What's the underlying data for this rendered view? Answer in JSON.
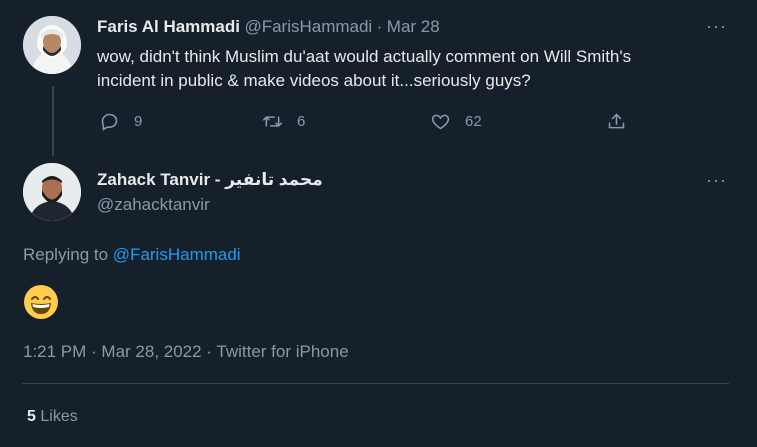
{
  "parent_tweet": {
    "author_name": "Faris Al Hammadi",
    "author_handle": "@FarisHammadi",
    "separator": "·",
    "date": "Mar 28",
    "text_line1": "wow, didn't think Muslim du'aat would actually comment on Will Smith's",
    "text_line2": "incident in public & make videos about it...seriously guys?",
    "replies": "9",
    "retweets": "6",
    "likes": "62"
  },
  "reply_tweet": {
    "author_name": "Zahack Tanvir - محمد تانفير",
    "author_handle": "@zahacktanvir",
    "replying_to_label": "Replying to",
    "replying_to_handle": "@FarisHammadi",
    "emoji": "😁",
    "timestamp": "1:21 PM · Mar 28, 2022 · Twitter for iPhone",
    "likes_count": "5",
    "likes_label": "Likes"
  },
  "more_label": "···",
  "colors": {
    "background": "#15202b",
    "link": "#1d9bf0",
    "muted": "#8b98a5",
    "divider": "#38444d"
  }
}
